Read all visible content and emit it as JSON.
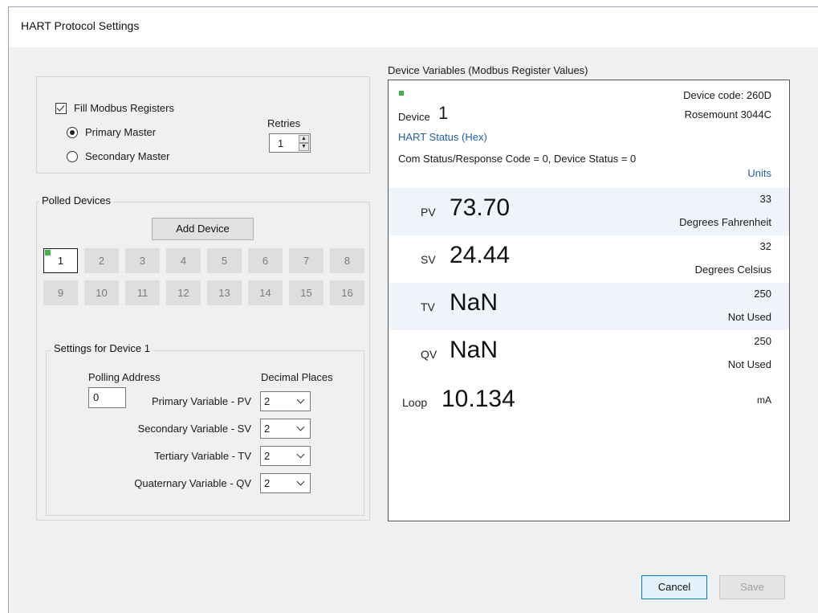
{
  "window": {
    "title": "HART Protocol Settings"
  },
  "modbus": {
    "fill_label": "Fill Modbus Registers",
    "fill_checked": true,
    "primary_label": "Primary Master",
    "secondary_label": "Secondary Master",
    "selected_master": "Primary Master",
    "retries_label": "Retries",
    "retries_value": "1"
  },
  "polled": {
    "label": "Polled Devices",
    "add_label": "Add Device",
    "devices": [
      "1",
      "2",
      "3",
      "4",
      "5",
      "6",
      "7",
      "8",
      "9",
      "10",
      "11",
      "12",
      "13",
      "14",
      "15",
      "16"
    ],
    "selected_device": "1"
  },
  "settings": {
    "label": "Settings for Device 1",
    "polling_label": "Polling Address",
    "polling_value": "0",
    "decimal_label": "Decimal Places",
    "vars": [
      {
        "label": "Primary Variable - PV",
        "value": "2"
      },
      {
        "label": "Secondary Variable - SV",
        "value": "2"
      },
      {
        "label": "Tertiary Variable - TV",
        "value": "2"
      },
      {
        "label": "Quaternary Variable - QV",
        "value": "2"
      }
    ]
  },
  "device_vars": {
    "heading": "Device Variables (Modbus Register Values)",
    "device_word": "Device",
    "device_num": "1",
    "device_code": "Device code: 260D",
    "model": "Rosemount  3044C",
    "hart_status": "HART Status (Hex)",
    "com_status": "Com Status/Response Code = 0, Device Status = 0",
    "units_header": "Units",
    "rows": [
      {
        "label": "PV",
        "value": "73.70",
        "code": "33",
        "unit": "Degrees Fahrenheit"
      },
      {
        "label": "SV",
        "value": "24.44",
        "code": "32",
        "unit": "Degrees Celsius"
      },
      {
        "label": "TV",
        "value": "NaN",
        "code": "250",
        "unit": "Not Used"
      },
      {
        "label": "QV",
        "value": "NaN",
        "code": "250",
        "unit": "Not Used"
      }
    ],
    "loop": {
      "label": "Loop",
      "value": "10.134",
      "unit": "mA"
    }
  },
  "footer": {
    "cancel": "Cancel",
    "save": "Save"
  },
  "colors": {
    "accent_blue": "#1f5fb0",
    "status_green": "#3cb44b",
    "row_tint": "#eef4fa"
  }
}
